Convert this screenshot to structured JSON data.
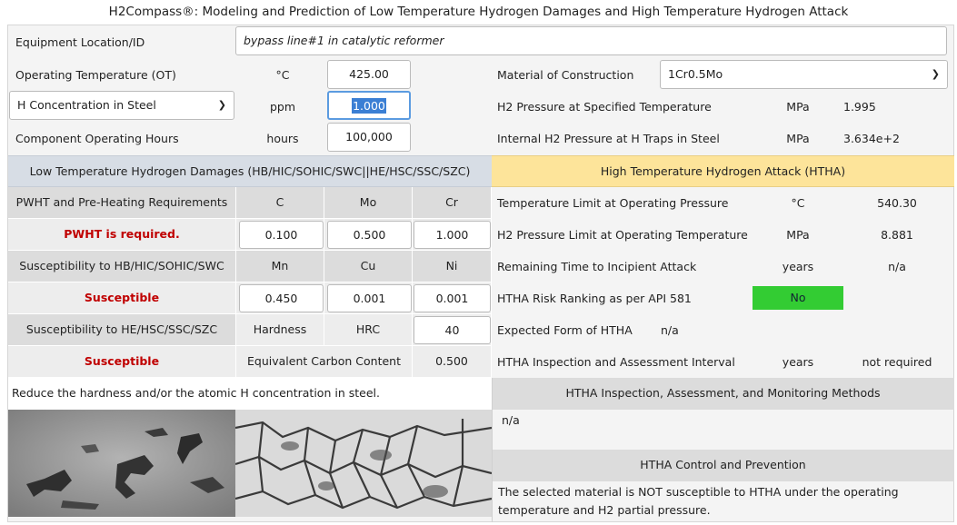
{
  "app": {
    "title": "H2Compass®: Modeling and Prediction of Low Temperature Hydrogen Damages and High Temperature Hydrogen Attack"
  },
  "inputs": {
    "equipment_location_label": "Equipment Location/ID",
    "equipment_location_value": "bypass line#1 in catalytic reformer",
    "operating_temp_label": "Operating Temperature (OT)",
    "operating_temp_unit": "°C",
    "operating_temp_value": "425.00",
    "h_conc_select": "H Concentration in Steel",
    "h_conc_unit": "ppm",
    "h_conc_value": "1.000",
    "hours_label": "Component Operating Hours",
    "hours_unit": "hours",
    "hours_value": "100,000",
    "material_label": "Material of Construction",
    "material_value": "1Cr0.5Mo",
    "h2_pressure_label": "H2 Pressure at Specified Temperature",
    "h2_pressure_unit": "MPa",
    "h2_pressure_value": "1.995",
    "internal_pressure_label": "Internal H2 Pressure at H Traps in Steel",
    "internal_pressure_unit": "MPa",
    "internal_pressure_value": "3.634e+2"
  },
  "left": {
    "band": "Low Temperature Hydrogen Damages (HB/HIC/SOHIC/SWC||HE/HSC/SSC/SZC)",
    "pwht_label": "PWHT and Pre-Heating Requirements",
    "col_c": "C",
    "col_mo": "Mo",
    "col_cr": "Cr",
    "pwht_result": "PWHT is required.",
    "val_c": "0.100",
    "val_mo": "0.500",
    "val_cr": "1.000",
    "hb_label": "Susceptibility to HB/HIC/SOHIC/SWC",
    "col_mn": "Mn",
    "col_cu": "Cu",
    "col_ni": "Ni",
    "hb_result": "Susceptible",
    "val_mn": "0.450",
    "val_cu": "0.001",
    "val_ni": "0.001",
    "he_label": "Susceptibility to HE/HSC/SSC/SZC",
    "hardness_label": "Hardness",
    "hardness_unit": "HRC",
    "hardness_value": "40",
    "he_result": "Susceptible",
    "ce_label": "Equivalent Carbon Content",
    "ce_value": "0.500",
    "advice": "Reduce the hardness and/or the atomic H concentration in steel."
  },
  "right": {
    "band": "High Temperature Hydrogen Attack (HTHA)",
    "temp_limit_label": "Temperature Limit at Operating Pressure",
    "temp_limit_unit": "°C",
    "temp_limit_value": "540.30",
    "press_limit_label": "H2 Pressure Limit at Operating Temperature",
    "press_limit_unit": "MPa",
    "press_limit_value": "8.881",
    "remaining_label": "Remaining Time to Incipient Attack",
    "remaining_unit": "years",
    "remaining_value": "n/a",
    "risk_label": "HTHA Risk Ranking as per API 581",
    "risk_value": "No",
    "form_label": "Expected Form of HTHA",
    "form_value": "n/a",
    "interval_label": "HTHA Inspection and Assessment Interval",
    "interval_unit": "years",
    "interval_value": "not required",
    "methods_head": "HTHA Inspection, Assessment, and Monitoring  Methods",
    "methods_value": "n/a",
    "control_head": "HTHA Control and Prevention",
    "control_text": "The selected material is NOT susceptible to HTHA under the operating temperature and H2 partial pressure."
  },
  "colors": {
    "left_band": "#d7dde5",
    "right_band": "#fde49a",
    "risk_green": "#33cc33",
    "alert_red": "#c00000"
  }
}
